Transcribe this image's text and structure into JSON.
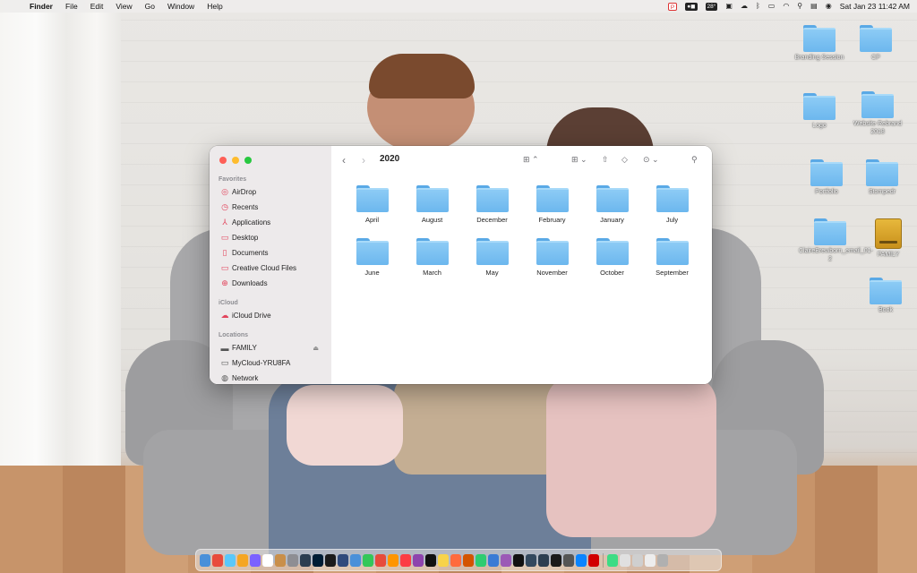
{
  "menubar": {
    "app_name": "Finder",
    "menus": [
      "File",
      "Edit",
      "View",
      "Go",
      "Window",
      "Help"
    ],
    "temperature": "28°",
    "clock": "Sat Jan 23  11:42 AM"
  },
  "desktop_icons": [
    {
      "label": "Branding Session",
      "kind": "folder"
    },
    {
      "label": "CP",
      "kind": "folder"
    },
    {
      "label": "Logo",
      "kind": "folder"
    },
    {
      "label": "Website Rebrand 2018",
      "kind": "folder"
    },
    {
      "label": "Portfolio",
      "kind": "folder"
    },
    {
      "label": "Stompedr",
      "kind": "folder"
    },
    {
      "label": "ClaireBrewborn_email_01-2",
      "kind": "folder"
    },
    {
      "label": "FAMILY",
      "kind": "drive"
    },
    {
      "label": "Book",
      "kind": "folder"
    }
  ],
  "finder": {
    "title": "2020",
    "sidebar": {
      "favorites_title": "Favorites",
      "favorites": [
        "AirDrop",
        "Recents",
        "Applications",
        "Desktop",
        "Documents",
        "Creative Cloud Files",
        "Downloads"
      ],
      "icloud_title": "iCloud",
      "icloud": [
        "iCloud Drive"
      ],
      "locations_title": "Locations",
      "locations": [
        "FAMILY",
        "MyCloud-YRU8FA",
        "Network"
      ]
    },
    "folders": [
      "April",
      "August",
      "December",
      "February",
      "January",
      "July",
      "June",
      "March",
      "May",
      "November",
      "October",
      "September"
    ]
  },
  "colors": {
    "folder": "#6cb7ee",
    "sidebar_icon": "#e2445c",
    "close": "#fe5f57",
    "minimize": "#febc2e",
    "zoom": "#28c840"
  },
  "dock_colors": [
    "#4a90d9",
    "#e84b3c",
    "#5ac8fa",
    "#f5a623",
    "#7b61ff",
    "#ffffff",
    "#c98f4a",
    "#8e8e93",
    "#2c3e50",
    "#001d34",
    "#1b1b1b",
    "#2f4a7c",
    "#4a90d9",
    "#34c759",
    "#e74c3c",
    "#ff9500",
    "#fc3c44",
    "#8e44ad",
    "#111111",
    "#f7d34a",
    "#ff6b3d",
    "#d35400",
    "#2ecc71",
    "#3a7bd5",
    "#9b59b6",
    "#111111",
    "#34495e",
    "#2c3e50",
    "#1a1a1a",
    "#555555",
    "#0a84ff",
    "#d10000",
    "#3ddc84",
    "#e0e0e0",
    "#cfcfcf",
    "#ededed",
    "#b0b0b0"
  ]
}
